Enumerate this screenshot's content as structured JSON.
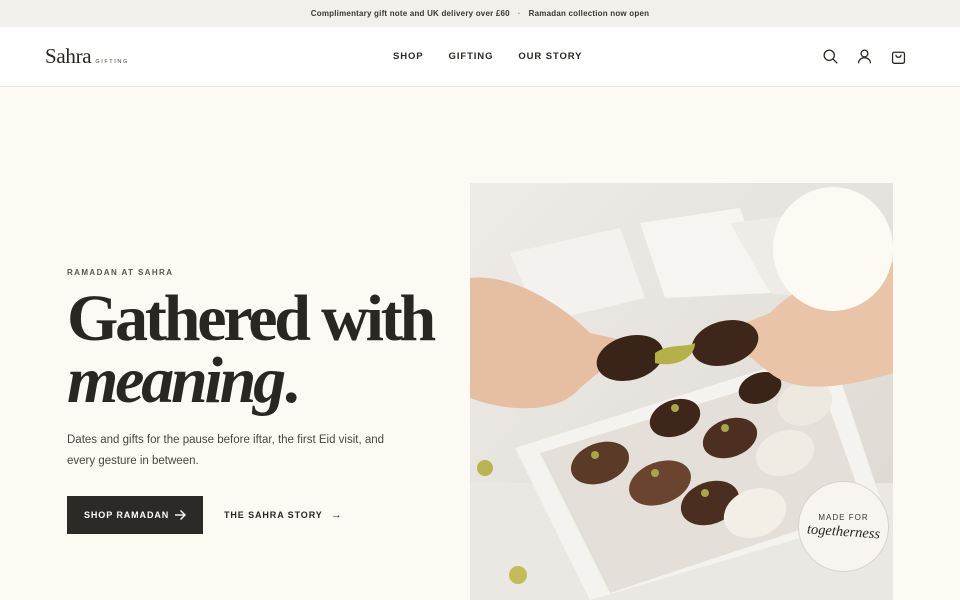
{
  "announcement": {
    "left": "Complimentary gift note and UK delivery over £60",
    "separator": "·",
    "right": "Ramadan collection now open"
  },
  "brand": {
    "name": "Sahra",
    "tagline": "GIFTING"
  },
  "nav": {
    "items": [
      "SHOP",
      "GIFTING",
      "OUR STORY"
    ]
  },
  "header_icons": [
    "search-icon",
    "account-icon",
    "cart-icon"
  ],
  "hero": {
    "eyebrow": "RAMADAN AT SAHRA",
    "headline_line1": "Gathered with",
    "headline_line2": "meaning",
    "headline_period": ".",
    "description": "Dates and gifts for the pause before iftar, the first Eid visit, and every gesture in between.",
    "primary_cta": "SHOP RAMADAN",
    "secondary_cta": "THE SAHRA STORY",
    "secondary_arrow": "→"
  },
  "badge": {
    "line1": "MADE FOR",
    "line2": "togetherness"
  },
  "colors": {
    "background": "#fdfaf4",
    "button": "#2c2a26",
    "text": "#2a2723",
    "announcement_bg": "#f2f0ea"
  }
}
